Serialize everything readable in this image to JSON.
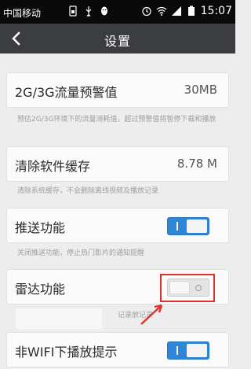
{
  "status_bar": {
    "carrier": "中国移动",
    "time": "15:07",
    "icons": [
      "sim-icon",
      "usb-icon",
      "qq-icon",
      "alarm-icon",
      "wifi-icon",
      "signal-icon",
      "battery-icon"
    ]
  },
  "header": {
    "title": "设置",
    "back_icon": "back-arrow-icon"
  },
  "settings": {
    "traffic_warning": {
      "label": "2G/3G流量预警值",
      "value": "30MB",
      "desc": "预估2G/3G环境下的流量消耗值，超过预警值将暂停下载和播放"
    },
    "clear_cache": {
      "label": "清除软件缓存",
      "value": "8.78 M",
      "desc": "清除系统缓存，不会删除离线视频及播放记录"
    },
    "push": {
      "label": "推送功能",
      "toggle_on": true,
      "desc": "关闭推送功能，停止热门影片的通知提醒"
    },
    "radar": {
      "label": "雷达功能",
      "toggle_on": false,
      "desc_partial": "记录放记录"
    },
    "non_wifi": {
      "label": "非WIFI下播放提示",
      "toggle_on": true
    }
  },
  "colors": {
    "status_bar_bg": "#0a0a0a",
    "header_bg": "#3c3d41",
    "toggle_on": "#2d86d8",
    "annotation_red": "#e1302c"
  }
}
